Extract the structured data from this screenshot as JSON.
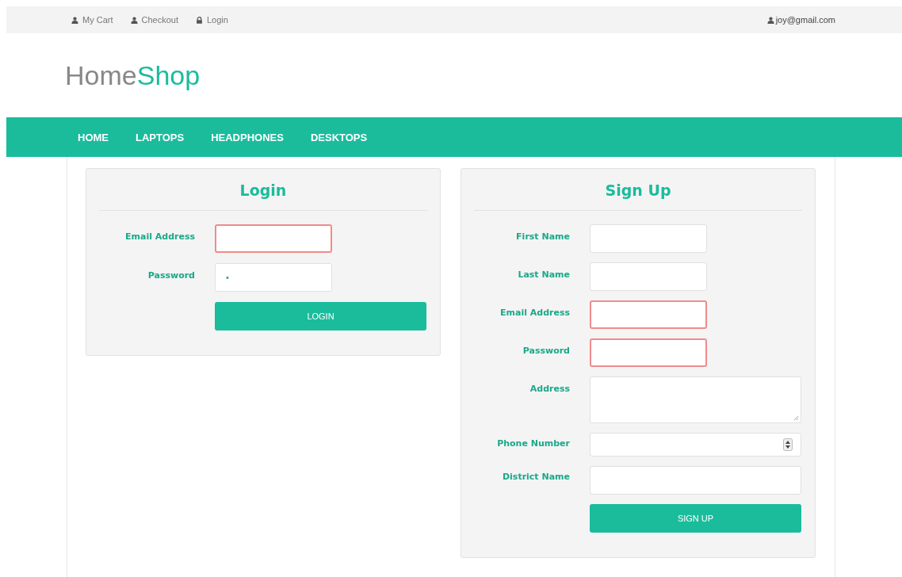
{
  "top_bar": {
    "links": [
      {
        "kind": "user",
        "label": "My Cart"
      },
      {
        "kind": "user",
        "label": "Checkout"
      },
      {
        "kind": "lock",
        "label": "Login"
      }
    ],
    "account": {
      "label": "joy@gmail.com"
    }
  },
  "logo": {
    "part_1": "Home",
    "part_2": "Shop"
  },
  "nav": {
    "items": [
      {
        "label": "HOME"
      },
      {
        "label": "LAPTOPS"
      },
      {
        "label": "HEADPHONES"
      },
      {
        "label": "DESKTOPS"
      }
    ]
  },
  "login": {
    "title": "Login",
    "fields": [
      {
        "label": "Email Address",
        "kind": "short",
        "invalid": true
      },
      {
        "label": "Password",
        "kind": "short",
        "invalid": false,
        "value": "•"
      }
    ],
    "button": "LOGIN"
  },
  "signup": {
    "title": "Sign Up",
    "fields": [
      {
        "label": "First Name",
        "kind": "short",
        "invalid": false
      },
      {
        "label": "Last Name",
        "kind": "short",
        "invalid": false
      },
      {
        "label": "Email Address",
        "kind": "short",
        "invalid": true
      },
      {
        "label": "Password",
        "kind": "short",
        "invalid": true
      },
      {
        "label": "Address",
        "kind": "textarea",
        "invalid": false
      },
      {
        "label": "Phone Number",
        "kind": "number",
        "invalid": false
      },
      {
        "label": "District Name",
        "kind": "long",
        "invalid": false
      }
    ],
    "button": "SIGN UP"
  }
}
